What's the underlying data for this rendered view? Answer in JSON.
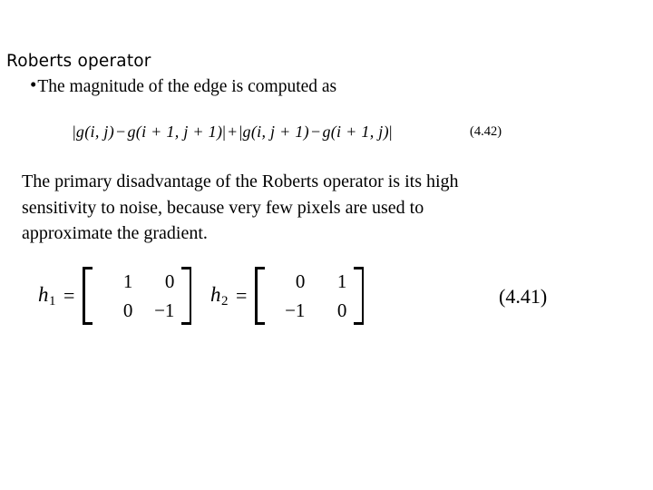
{
  "slide": {
    "background_color": "#ffffff",
    "text_color": "#000000",
    "title": "Roberts operator"
  },
  "bullet": {
    "marker": "•",
    "text": "The magnitude of the edge is computed as"
  },
  "equation_442": {
    "label": "(4.42)",
    "text": "|g(i, j) − g(i + 1, j + 1)| + |g(i, j + 1) − g(i + 1, j)|",
    "parts": {
      "abs_open_1": "|",
      "g1": "g",
      "arg1": "(i, j)",
      "minus_1": "−",
      "g2": "g",
      "arg2": "(i + 1, j + 1)",
      "abs_close_1": "|",
      "plus": "+",
      "abs_open_2": "|",
      "g3": "g",
      "arg3": "(i, j + 1)",
      "minus_2": "−",
      "g4": "g",
      "arg4": "(i + 1, j)",
      "abs_close_2": "|"
    }
  },
  "paragraph": {
    "line1": "The primary disadvantage of the Roberts operator is its high",
    "line2": "sensitivity to noise, because very few pixels are used to",
    "line3": "approximate the gradient.",
    "full_text": "The primary disadvantage of the Roberts operator is its high sensitivity to noise, because very few pixels are used to approximate the gradient."
  },
  "equation_441": {
    "label": "(4.41)",
    "equals": "=",
    "matrices": [
      {
        "name": "h",
        "subscript": "1",
        "rows": [
          [
            "1",
            "0"
          ],
          [
            "0",
            "−1"
          ]
        ]
      },
      {
        "name": "h",
        "subscript": "2",
        "rows": [
          [
            "0",
            "1"
          ],
          [
            "−1",
            "0"
          ]
        ]
      }
    ]
  }
}
